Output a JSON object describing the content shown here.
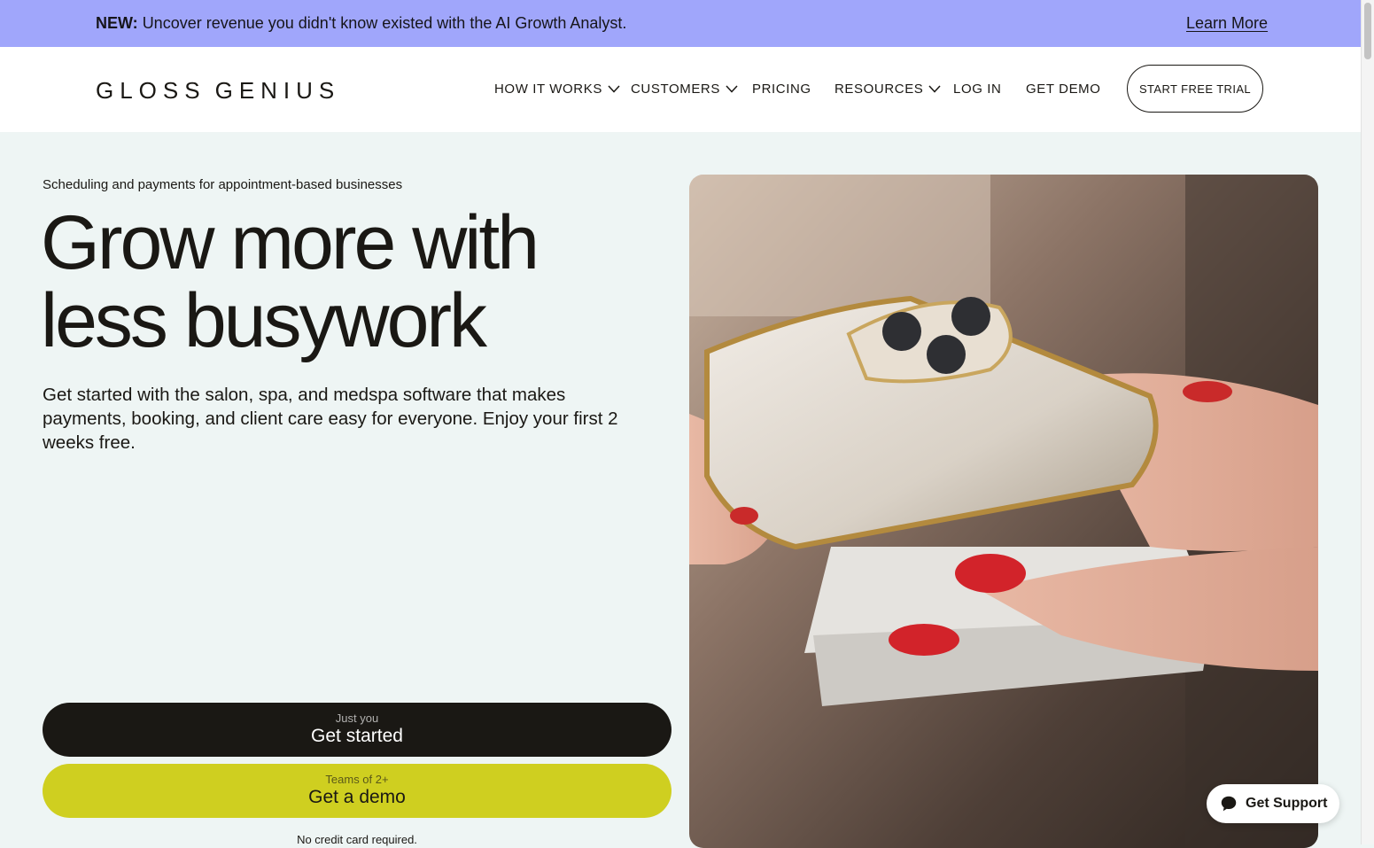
{
  "banner": {
    "prefix": "NEW:",
    "message": "Uncover revenue you didn't know existed with the AI Growth Analyst.",
    "link": "Learn More",
    "background": "#a0a6fb"
  },
  "nav": {
    "logo_word1": "GLOSS",
    "logo_word2": "GENIUS",
    "items": [
      {
        "label": "HOW IT WORKS",
        "icon": "chevron-down-icon"
      },
      {
        "label": "CUSTOMERS",
        "icon": "chevron-down-icon"
      },
      {
        "label": "PRICING"
      },
      {
        "label": "RESOURCES",
        "icon": "chevron-down-icon"
      },
      {
        "label": "LOG IN"
      },
      {
        "label": "GET DEMO"
      }
    ],
    "cta": "START FREE TRIAL"
  },
  "hero": {
    "eyebrow": "Scheduling and payments for appointment-based businesses",
    "headline_line1": "Grow more with",
    "headline_line2": "less busywork",
    "subtext": "Get started with the salon, spa, and medspa software that makes payments, booking, and client care easy for everyone. Enjoy your first 2 weeks free.",
    "primary_small": "Just you",
    "primary_big": "Get started",
    "secondary_small": "Teams of 2+",
    "secondary_big": "Get a demo",
    "note": "No credit card required.",
    "colors": {
      "background": "#eef5f4",
      "dark": "#1a1814",
      "lime": "#cfcf20"
    }
  },
  "support": {
    "label": "Get Support",
    "icon": "chat-bubble-icon"
  }
}
